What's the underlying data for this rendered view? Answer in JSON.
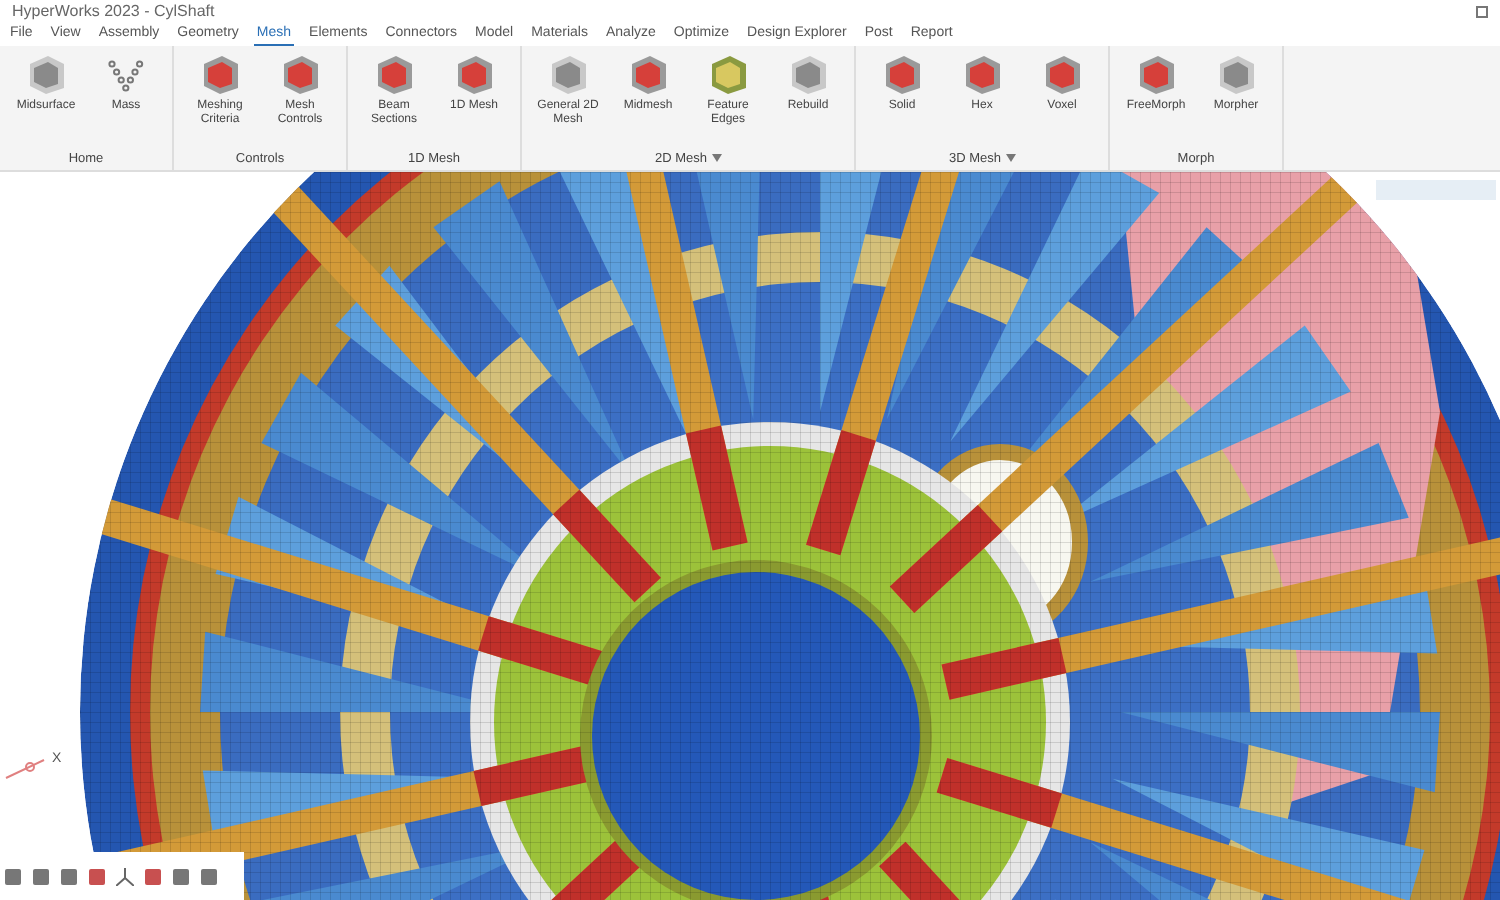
{
  "window": {
    "title": "HyperWorks 2023 - CylShaft"
  },
  "menu_tabs": [
    {
      "label": "File",
      "selected": false
    },
    {
      "label": "View",
      "selected": false
    },
    {
      "label": "Assembly",
      "selected": false
    },
    {
      "label": "Geometry",
      "selected": false
    },
    {
      "label": "Mesh",
      "selected": true
    },
    {
      "label": "Elements",
      "selected": false
    },
    {
      "label": "Connectors",
      "selected": false
    },
    {
      "label": "Model",
      "selected": false
    },
    {
      "label": "Materials",
      "selected": false
    },
    {
      "label": "Analyze",
      "selected": false
    },
    {
      "label": "Optimize",
      "selected": false
    },
    {
      "label": "Design Explorer",
      "selected": false
    },
    {
      "label": "Post",
      "selected": false
    },
    {
      "label": "Report",
      "selected": false
    }
  ],
  "ribbon_groups": [
    {
      "label": "Home",
      "has_menu": false,
      "tools": [
        {
          "label": "Midsurface",
          "kind": "gray"
        },
        {
          "label": "Mass",
          "kind": "dots"
        }
      ]
    },
    {
      "label": "Controls",
      "has_menu": false,
      "tools": [
        {
          "label": "Meshing Criteria",
          "kind": "red"
        },
        {
          "label": "Mesh Controls",
          "kind": "red"
        }
      ]
    },
    {
      "label": "1D Mesh",
      "has_menu": false,
      "tools": [
        {
          "label": "Beam Sections",
          "kind": "red"
        },
        {
          "label": "1D Mesh",
          "kind": "red"
        }
      ]
    },
    {
      "label": "2D Mesh",
      "has_menu": true,
      "tools": [
        {
          "label": "General 2D Mesh",
          "kind": "gray"
        },
        {
          "label": "Midmesh",
          "kind": "red"
        },
        {
          "label": "Feature Edges",
          "kind": "yellow"
        },
        {
          "label": "Rebuild",
          "kind": "gray"
        }
      ]
    },
    {
      "label": "3D Mesh",
      "has_menu": true,
      "tools": [
        {
          "label": "Solid",
          "kind": "red"
        },
        {
          "label": "Hex",
          "kind": "red"
        },
        {
          "label": "Voxel",
          "kind": "red"
        }
      ]
    },
    {
      "label": "Morph",
      "has_menu": false,
      "tools": [
        {
          "label": "FreeMorph",
          "kind": "red"
        },
        {
          "label": "Morpher",
          "kind": "gray"
        }
      ]
    }
  ],
  "viewport": {
    "axis_label": "X"
  }
}
